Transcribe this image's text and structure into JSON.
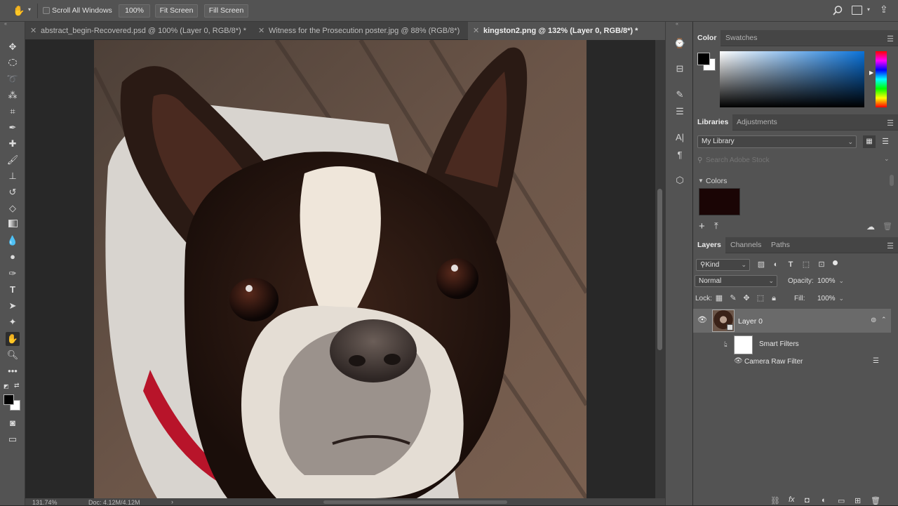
{
  "options_bar": {
    "scroll_all_windows": "Scroll All Windows",
    "zoom_btn": "100%",
    "fit_screen": "Fit Screen",
    "fill_screen": "Fill Screen"
  },
  "tabs": [
    {
      "label": "abstract_begin-Recovered.psd @ 100% (Layer 0, RGB/8*) *"
    },
    {
      "label": "Witness for the Prosecution poster.jpg @ 88% (RGB/8*)"
    },
    {
      "label": "kingston2.png @ 132% (Layer 0, RGB/8*) *"
    }
  ],
  "status": {
    "zoom": "131.74%",
    "doc": "Doc: 4.12M/4.12M"
  },
  "color_panel": {
    "tab_color": "Color",
    "tab_swatches": "Swatches",
    "foreground": "#000000",
    "background": "#ffffff"
  },
  "libraries_panel": {
    "tab_libraries": "Libraries",
    "tab_adjustments": "Adjustments",
    "library_name": "My Library",
    "search_placeholder": "Search Adobe Stock",
    "colors_heading": "Colors",
    "swatch_color": "#1a0505"
  },
  "layers_panel": {
    "tab_layers": "Layers",
    "tab_channels": "Channels",
    "tab_paths": "Paths",
    "kind": "Kind",
    "blend_mode": "Normal",
    "opacity_label": "Opacity:",
    "opacity_value": "100%",
    "lock_label": "Lock:",
    "fill_label": "Fill:",
    "fill_value": "100%",
    "layer_name": "Layer 0",
    "smart_filters": "Smart Filters",
    "filter_name": "Camera Raw Filter"
  }
}
